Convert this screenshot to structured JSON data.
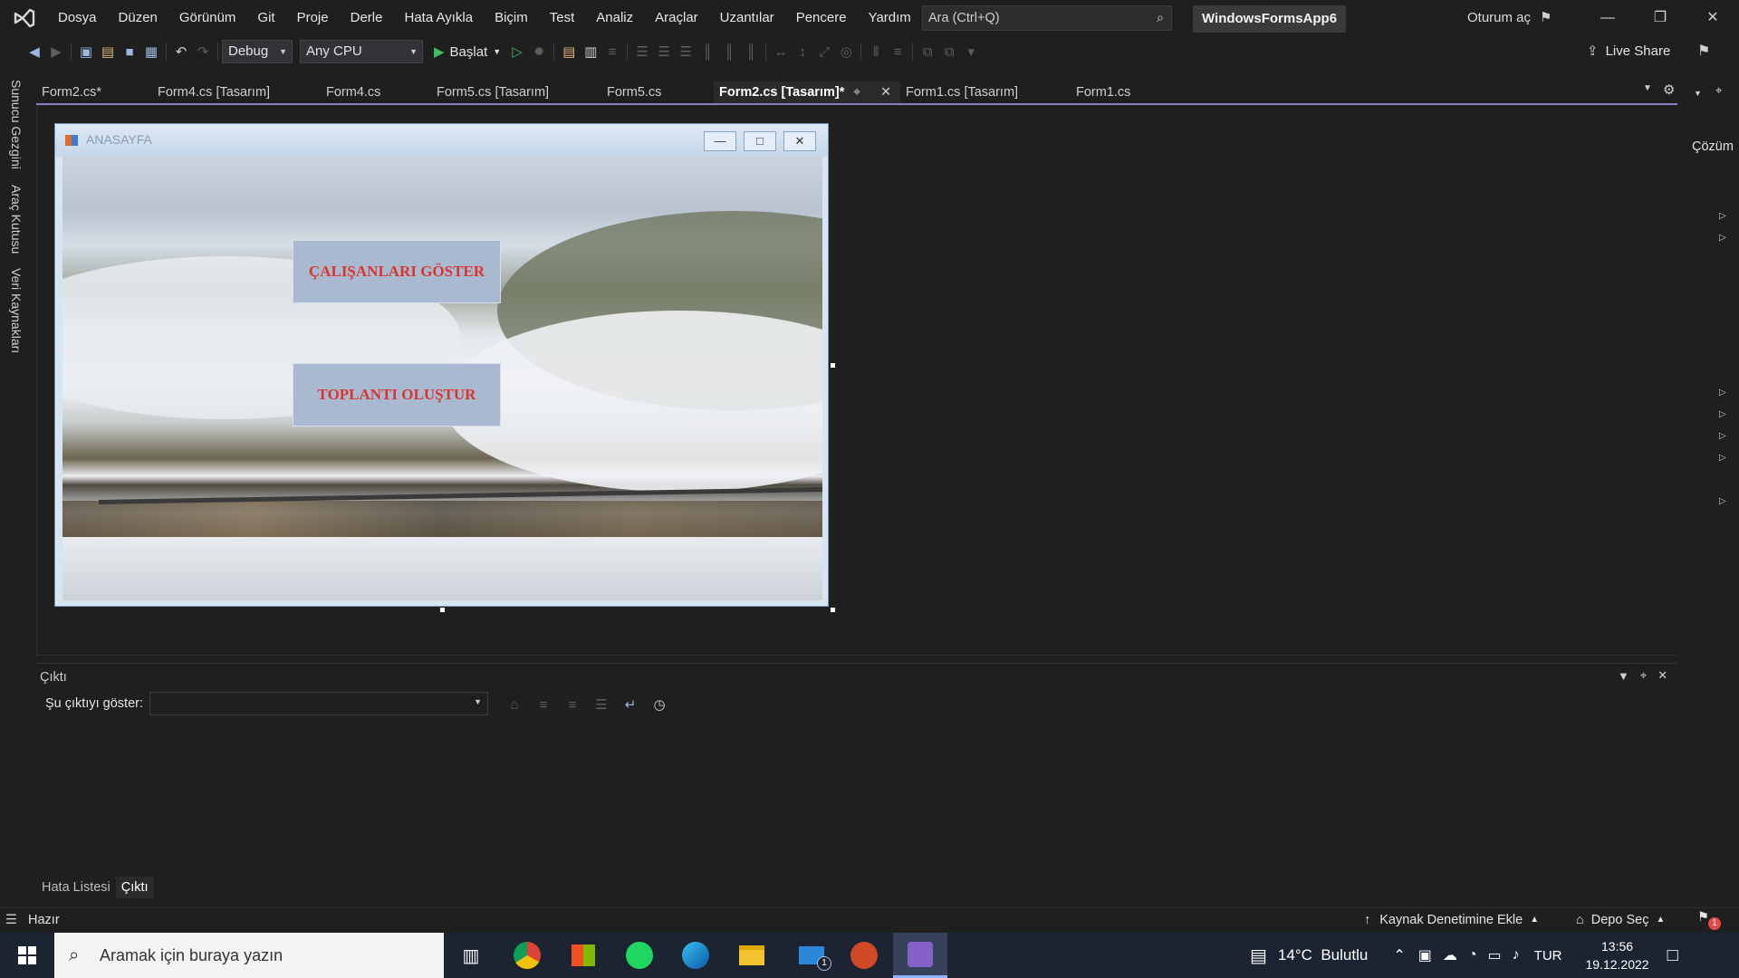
{
  "menu": {
    "items": [
      "Dosya",
      "Düzen",
      "Görünüm",
      "Git",
      "Proje",
      "Derle",
      "Hata Ayıkla",
      "Biçim",
      "Test",
      "Analiz",
      "Araçlar",
      "Uzantılar",
      "Pencere",
      "Yardım"
    ],
    "search_placeholder": "Ara (Ctrl+Q)",
    "solution_name": "WindowsFormsApp6",
    "sign_in": "Oturum aç"
  },
  "toolbar": {
    "config": "Debug",
    "platform": "Any CPU",
    "start_label": "Başlat",
    "live_share": "Live Share"
  },
  "side_tabs": [
    "Sunucu Gezgini",
    "Araç Kutusu",
    "Veri Kaynakları"
  ],
  "doc_tabs": [
    "Form2.cs*",
    "Form4.cs [Tasarım]",
    "Form4.cs",
    "Form5.cs [Tasarım]",
    "Form5.cs",
    "Form2.cs [Tasarım]*",
    "Form1.cs [Tasarım]",
    "Form1.cs"
  ],
  "right_panel_label": "Çözüm",
  "form": {
    "title": "ANASAYFA",
    "button1": "ÇALIŞANLARI GÖSTER",
    "button2": "TOPLANTI OLUŞTUR"
  },
  "output": {
    "title": "Çıktı",
    "show_label": "Şu çıktıyı göster:",
    "bottom_tabs": [
      "Hata Listesi",
      "Çıktı"
    ]
  },
  "status": {
    "ready": "Hazır",
    "source_control": "Kaynak Denetimine Ekle",
    "repo": "Depo Seç",
    "notification_count": "1"
  },
  "taskbar": {
    "search_placeholder": "Aramak için buraya yazın",
    "weather": "14°C  Bulutlu",
    "language": "TUR",
    "time": "13:56",
    "date": "19.12.2022",
    "mail_badge": "1"
  },
  "colors": {
    "accent": "#8e7cc3",
    "form_button_text": "#d9352e"
  }
}
